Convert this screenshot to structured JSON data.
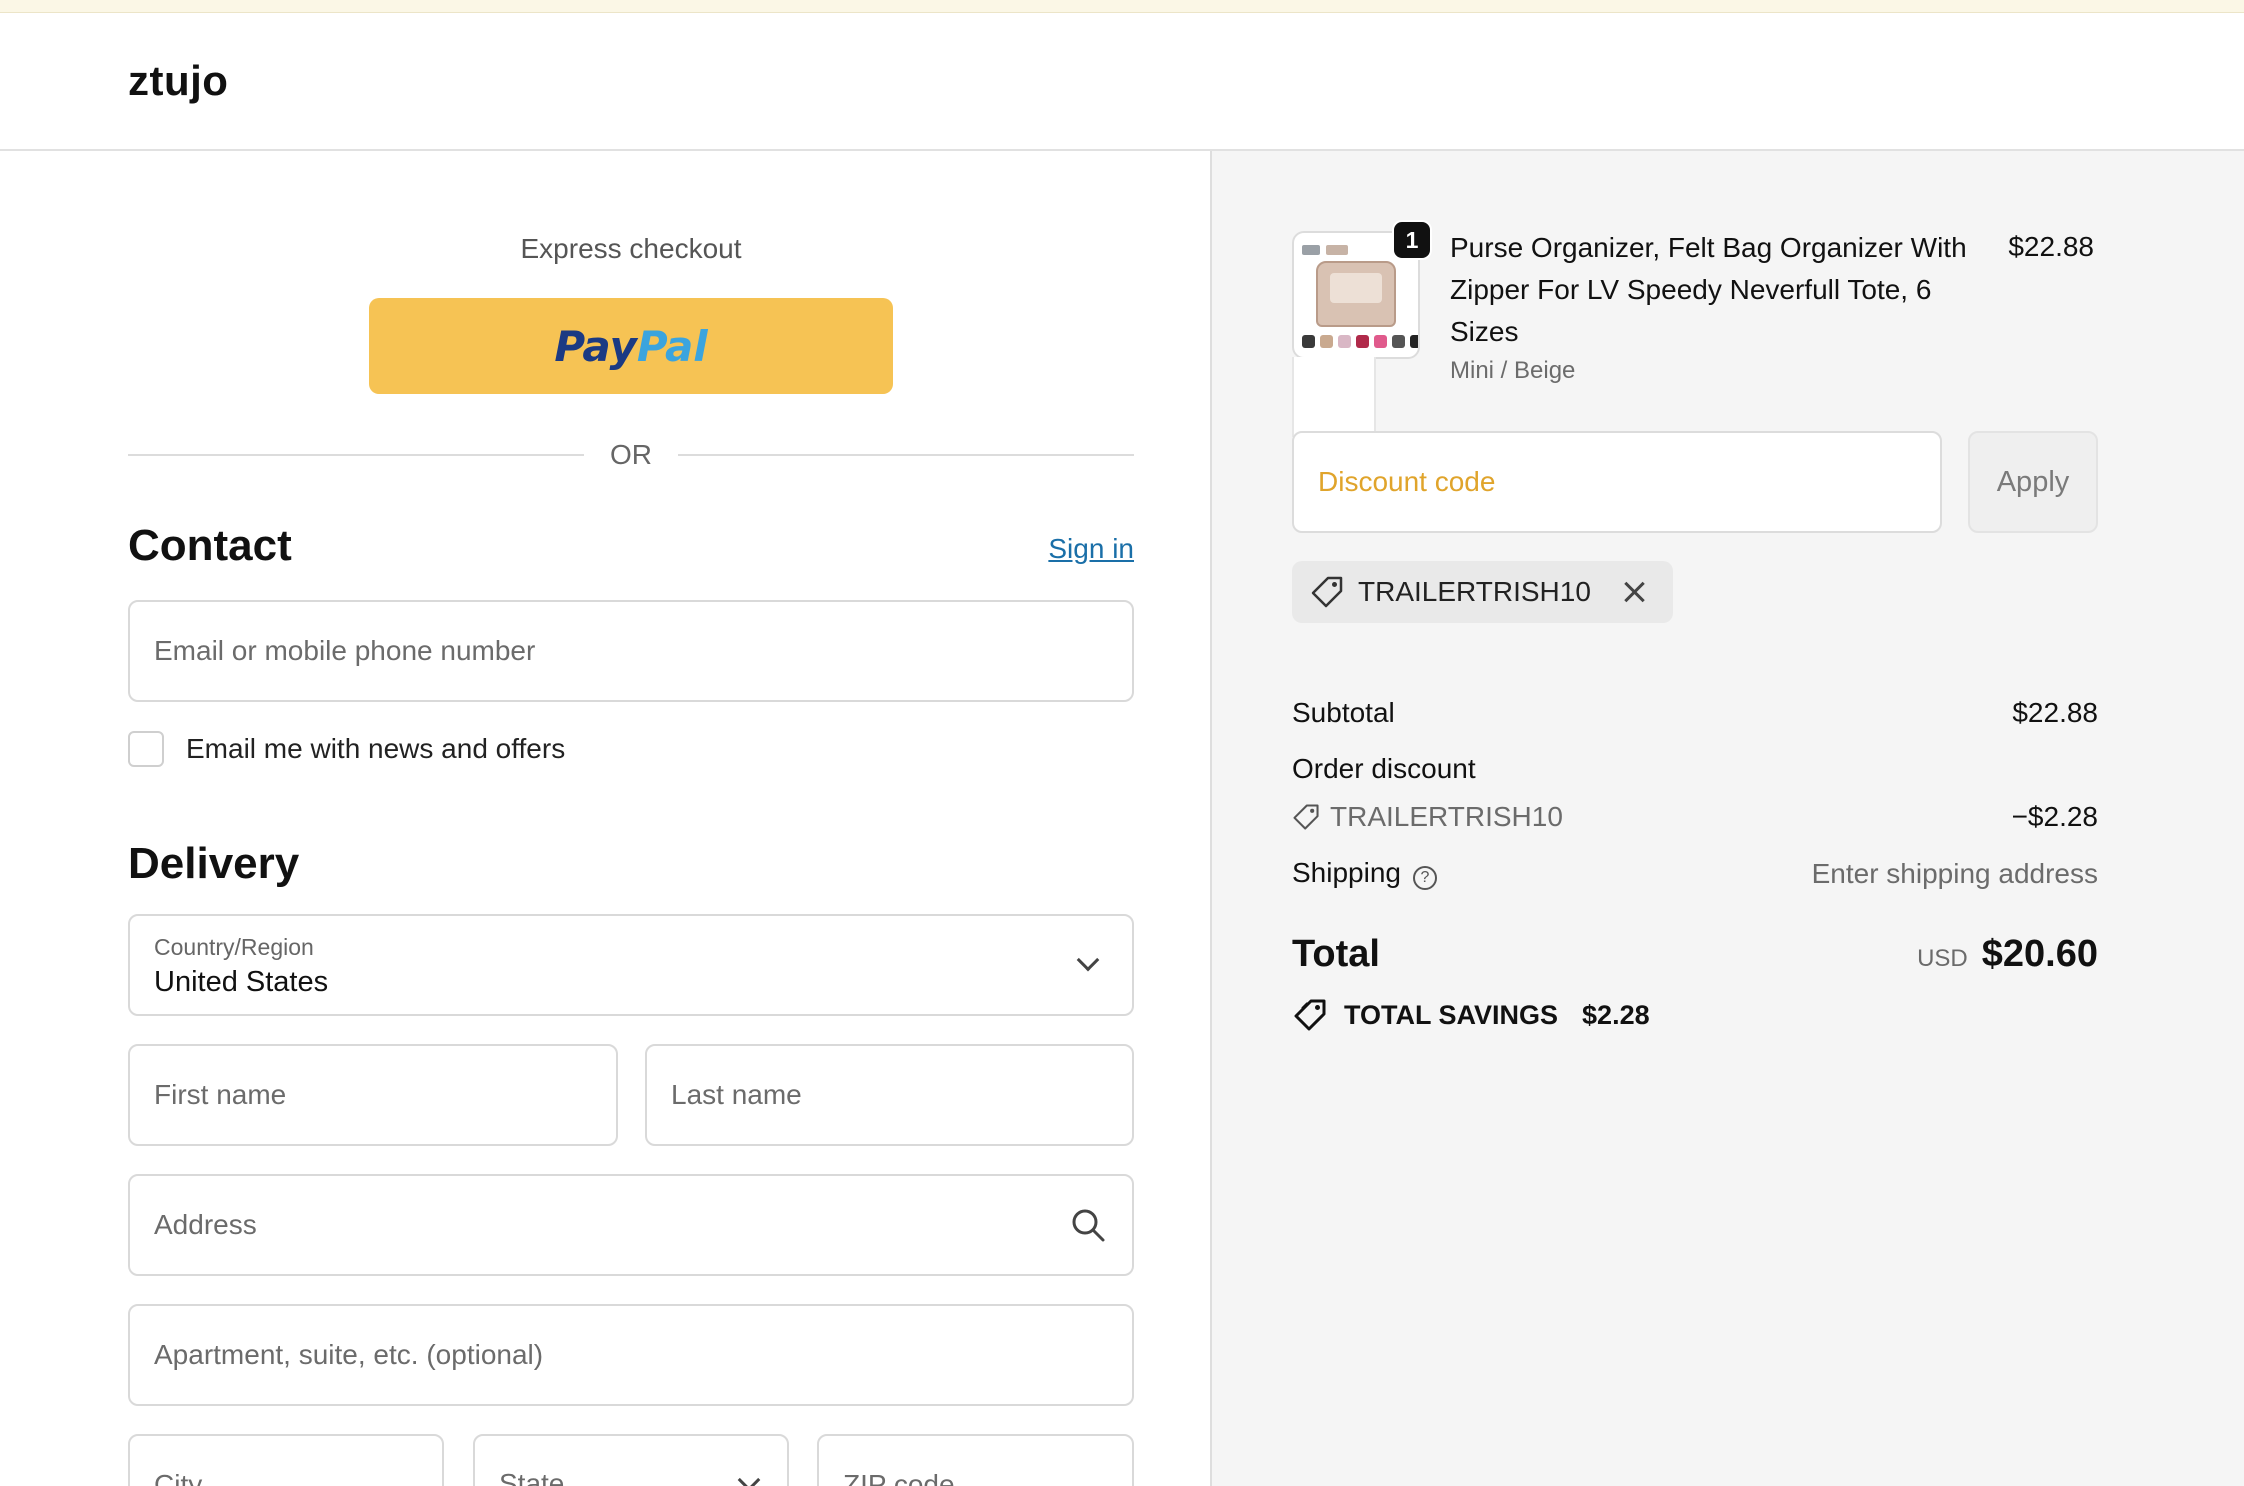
{
  "brand": "ztujo",
  "express": {
    "label": "Express checkout",
    "paypal_pay": "Pay",
    "paypal_pal": "Pal",
    "or": "OR"
  },
  "contact": {
    "title": "Contact",
    "sign_in": "Sign in",
    "email_placeholder": "Email or mobile phone number",
    "newsletter_label": "Email me with news and offers"
  },
  "delivery": {
    "title": "Delivery",
    "country_label": "Country/Region",
    "country_value": "United States",
    "first_name_placeholder": "First name",
    "last_name_placeholder": "Last name",
    "address_placeholder": "Address",
    "apartment_placeholder": "Apartment, suite, etc. (optional)",
    "city_placeholder": "City",
    "state_label": "State",
    "zip_placeholder": "ZIP code"
  },
  "order": {
    "quantity": "1",
    "product_name": "Purse Organizer, Felt Bag Organizer With Zipper For LV Speedy Neverfull Tote, 6 Sizes",
    "variant": "Mini / Beige",
    "price": "$22.88",
    "discount_placeholder": "Discount code",
    "apply_label": "Apply",
    "applied_code": "TRAILERTRISH10",
    "subtotal_label": "Subtotal",
    "subtotal_value": "$22.88",
    "order_discount_label": "Order discount",
    "discount_code": "TRAILERTRISH10",
    "discount_value": "−$2.28",
    "shipping_label": "Shipping",
    "shipping_value": "Enter shipping address",
    "total_label": "Total",
    "currency": "USD",
    "total_value": "$20.60",
    "savings_label": "TOTAL SAVINGS",
    "savings_value": "$2.28"
  },
  "colors": {
    "paypal_yellow": "#f6c354",
    "link_blue": "#1a6fa8",
    "discount_placeholder": "#e0a42b"
  }
}
